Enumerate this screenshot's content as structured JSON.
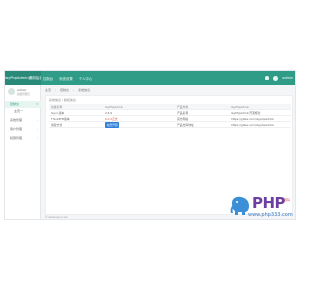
{
  "topbar": {
    "brand": "layPhpAdmin通用后台",
    "nav": [
      "控制台",
      "系统设置",
      "个人中心"
    ],
    "user": "admin"
  },
  "sidebar": {
    "user_name": "admin",
    "user_role": "超级管理员",
    "items": [
      {
        "label": "控制台",
        "active": true
      },
      {
        "label": "主页一",
        "active": false
      },
      {
        "label": "系统管理",
        "active": false
      },
      {
        "label": "用户管理",
        "active": false
      },
      {
        "label": "权限管理",
        "active": false
      }
    ]
  },
  "breadcrumb": [
    "主页",
    "控制台",
    "系统信息"
  ],
  "panel": {
    "title": "系统信息 / 版权信息",
    "header": [
      "系统名称",
      "layPhpAdmin",
      "产品作者",
      "layPhpAdmin"
    ],
    "rows": [
      [
        "layui 版本",
        "2.5.6",
        "产品名称",
        "layPhpAdmin开源框架"
      ],
      [
        "ThinkPHP版本",
        "6.0.2正式",
        "官方网站",
        "https://gitee.com/layphpadmin"
      ],
      [
        "授权方式",
        "免费开源",
        "产品仓库地址",
        "https://gitee.com/layphpadmin"
      ]
    ]
  },
  "footer": "© www.layui.com",
  "watermark": {
    "logo_text": "PHP",
    "cn_text": "源码",
    "url": "www.php333.com"
  }
}
